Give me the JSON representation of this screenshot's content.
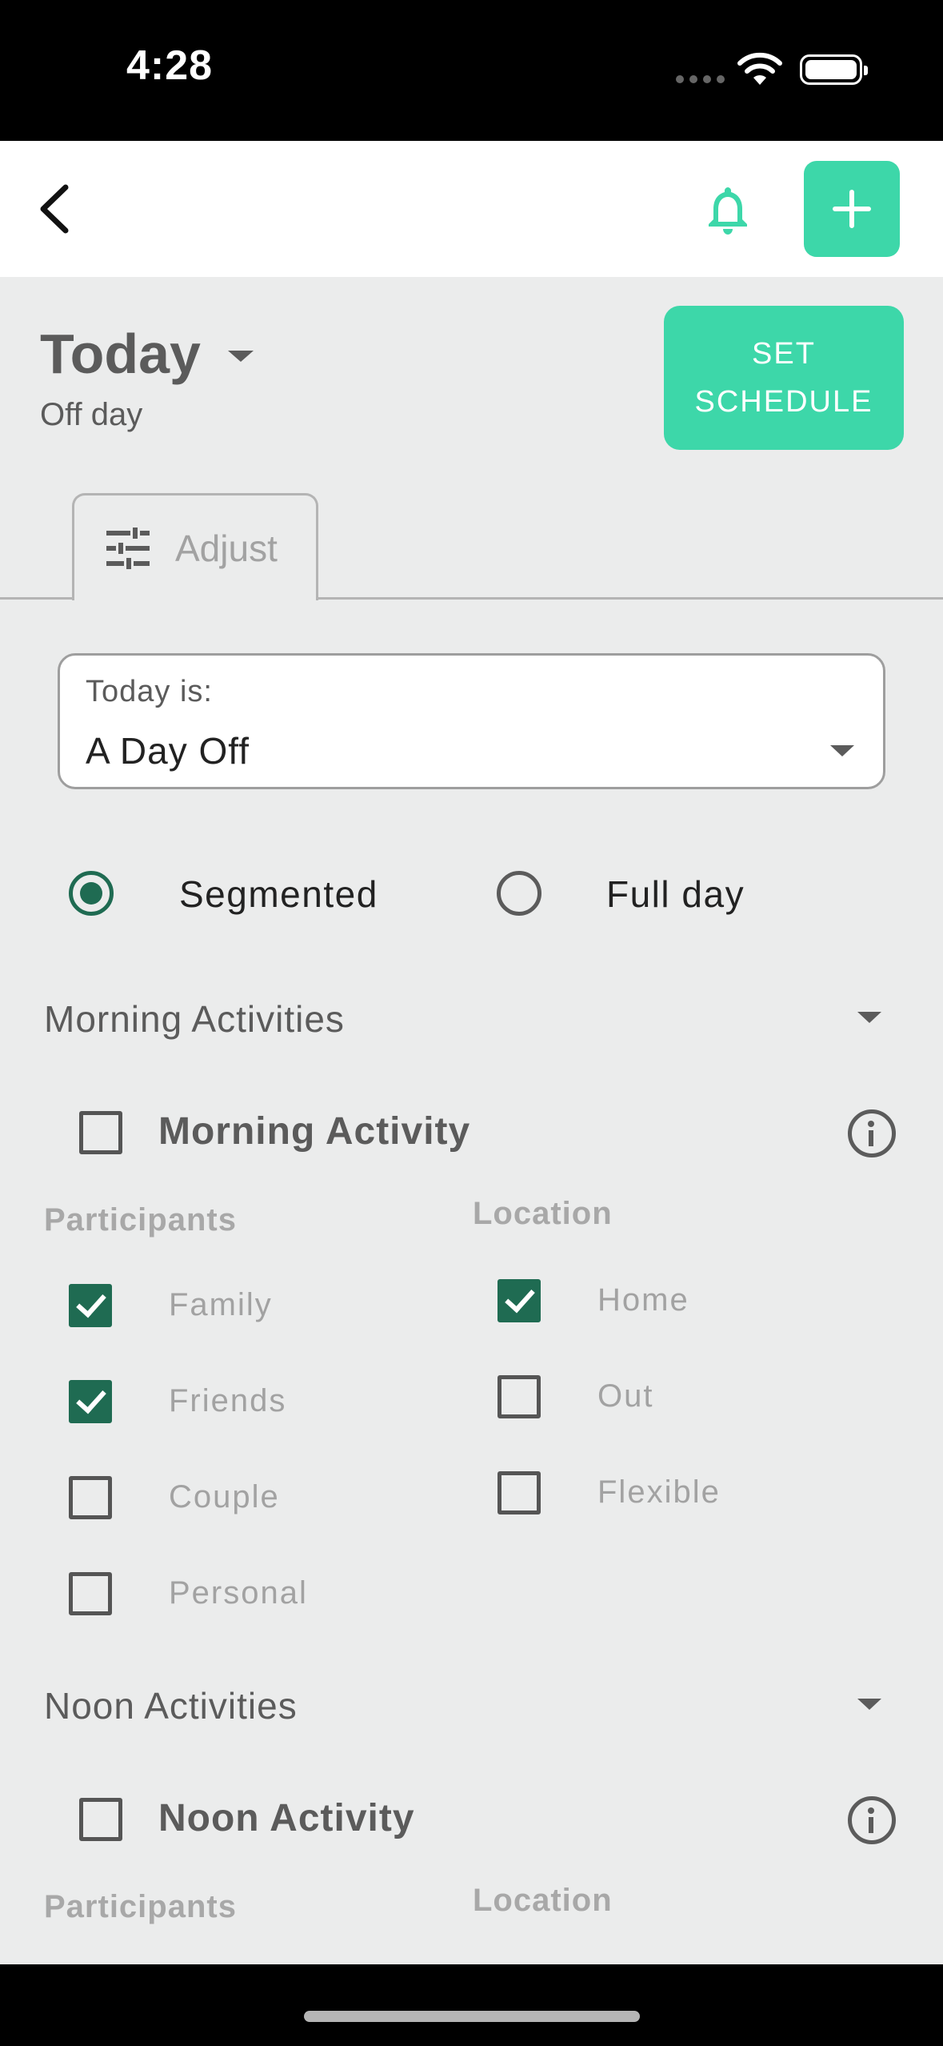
{
  "status_bar": {
    "time": "4:28"
  },
  "header": {
    "back_icon": "chevron-left-icon",
    "bell_icon": "bell-icon",
    "add_icon": "plus-icon"
  },
  "page": {
    "title": "Today",
    "subtitle": "Off day",
    "set_schedule_label": "SET\nSCHEDULE"
  },
  "tabs": [
    {
      "label": "Adjust",
      "icon": "tune-icon"
    }
  ],
  "day_type_select": {
    "label": "Today is:",
    "value": "A Day Off"
  },
  "mode": {
    "options": [
      {
        "label": "Segmented",
        "selected": true
      },
      {
        "label": "Full day",
        "selected": false
      }
    ]
  },
  "sections": [
    {
      "title": "Morning Activities",
      "activity": {
        "label": "Morning Activity",
        "checked": false
      },
      "participants": {
        "label": "Participants",
        "options": [
          {
            "label": "Family",
            "checked": true
          },
          {
            "label": "Friends",
            "checked": true
          },
          {
            "label": "Couple",
            "checked": false
          },
          {
            "label": "Personal",
            "checked": false
          }
        ]
      },
      "location": {
        "label": "Location",
        "options": [
          {
            "label": "Home",
            "checked": true
          },
          {
            "label": "Out",
            "checked": false
          },
          {
            "label": "Flexible",
            "checked": false
          }
        ]
      }
    },
    {
      "title": "Noon Activities",
      "activity": {
        "label": "Noon Activity",
        "checked": false
      },
      "participants": {
        "label": "Participants"
      },
      "location": {
        "label": "Location"
      }
    }
  ],
  "colors": {
    "accent": "#3dd7a9",
    "checked": "#1f6b52",
    "background": "#ebecec"
  }
}
